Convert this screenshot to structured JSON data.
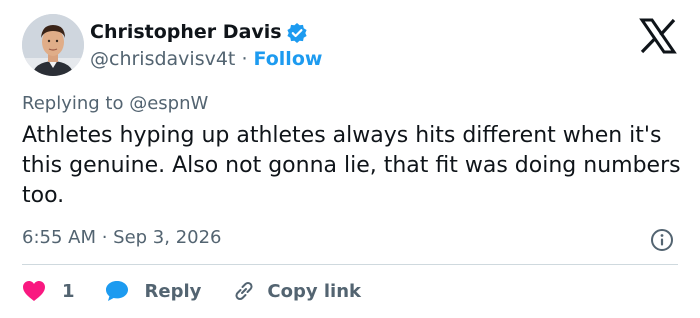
{
  "author": {
    "name": "Christopher Davis",
    "handle": "@chrisdavisv4t",
    "separator": "·",
    "follow_label": "Follow"
  },
  "replying_to": "Replying to @espnW",
  "body": "Athletes hyping up athletes always hits different when it's this genuine. Also not gonna lie, that fit was doing numbers too.",
  "timestamp": "6:55 AM · Sep 3, 2026",
  "actions": {
    "like_count": "1",
    "reply_label": "Reply",
    "copy_link_label": "Copy link"
  },
  "colors": {
    "accent": "#1d9bf0",
    "like": "#f91880",
    "muted": "#536471",
    "text": "#0f1419"
  },
  "icons": {
    "verified": "verified-badge-icon",
    "brand": "x-logo-icon",
    "info": "info-icon",
    "like": "heart-icon",
    "reply": "speech-bubble-icon",
    "copy": "link-icon"
  }
}
